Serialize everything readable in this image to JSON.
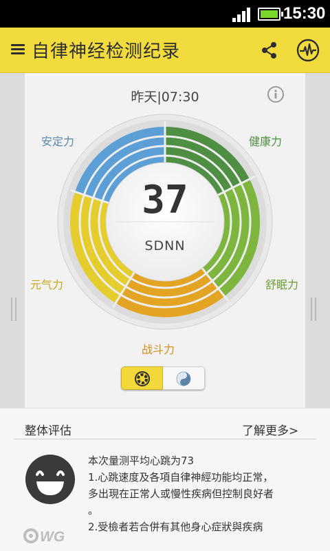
{
  "status_bar": {
    "time": "15:30"
  },
  "app_bar": {
    "title": "自律神经检测纪录"
  },
  "record": {
    "datetime": "昨天|07:30",
    "value": "37",
    "unit": "SDNN"
  },
  "gauge": {
    "segments": [
      {
        "label": "安定力",
        "color": "#5b9fd6"
      },
      {
        "label": "健康力",
        "color": "#4f8f43"
      },
      {
        "label": "舒眠力",
        "color": "#7db53e"
      },
      {
        "label": "战斗力",
        "color": "#e3a323"
      },
      {
        "label": "元气力",
        "color": "#e6cd2e"
      }
    ]
  },
  "assessment": {
    "title": "整体评估",
    "more_label": "了解更多>",
    "lines": [
      "本次量测平均心跳为73",
      "1.心跳速度及各項自律神經功能均正常，",
      "多出現在正常人或慢性疾病但控制良好者",
      "。",
      "2.受檢者若合併有其他身心症狀與疾病"
    ]
  },
  "brand": {
    "logo_text": "WG"
  }
}
